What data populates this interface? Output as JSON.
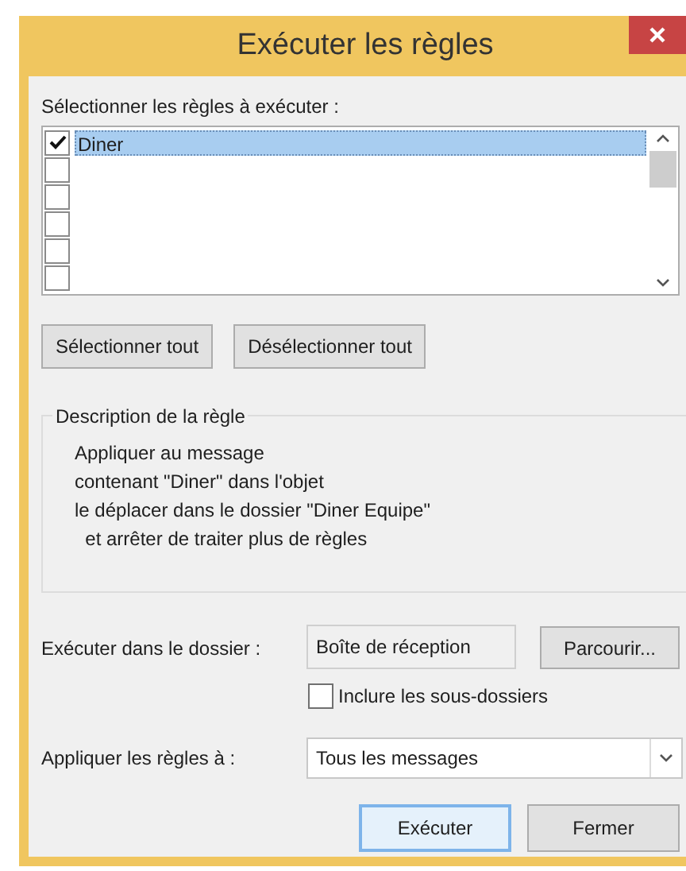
{
  "window": {
    "title": "Exécuter les règles"
  },
  "rules_label": "Sélectionner les règles à exécuter :",
  "rules": [
    {
      "label": "Diner",
      "checked": true,
      "selected": true
    },
    {
      "checked": false,
      "selected": false
    },
    {
      "checked": false,
      "selected": false
    },
    {
      "checked": false,
      "selected": false
    },
    {
      "checked": false,
      "selected": false
    },
    {
      "checked": false,
      "selected": false
    }
  ],
  "list_buttons": [
    "Sélectionner tout",
    "Désélectionner tout"
  ],
  "description": {
    "title": "Description de la règle",
    "lines": [
      "Appliquer au message",
      "contenant \"Diner\" dans l'objet",
      "le déplacer dans le dossier \"Diner Equipe\"",
      "  et arrêter de traiter plus de règles"
    ]
  },
  "folder": {
    "label": "Exécuter dans le dossier :",
    "value": "Boîte de réception",
    "browse_button": "Parcourir...",
    "include_subfolders": {
      "label": "Inclure les sous-dossiers",
      "checked": false
    }
  },
  "apply_to": {
    "label": "Appliquer les règles à :",
    "value": "Tous les messages"
  },
  "footer_buttons": [
    {
      "label": "Exécuter",
      "default": true
    },
    {
      "label": "Fermer",
      "default": false
    }
  ]
}
